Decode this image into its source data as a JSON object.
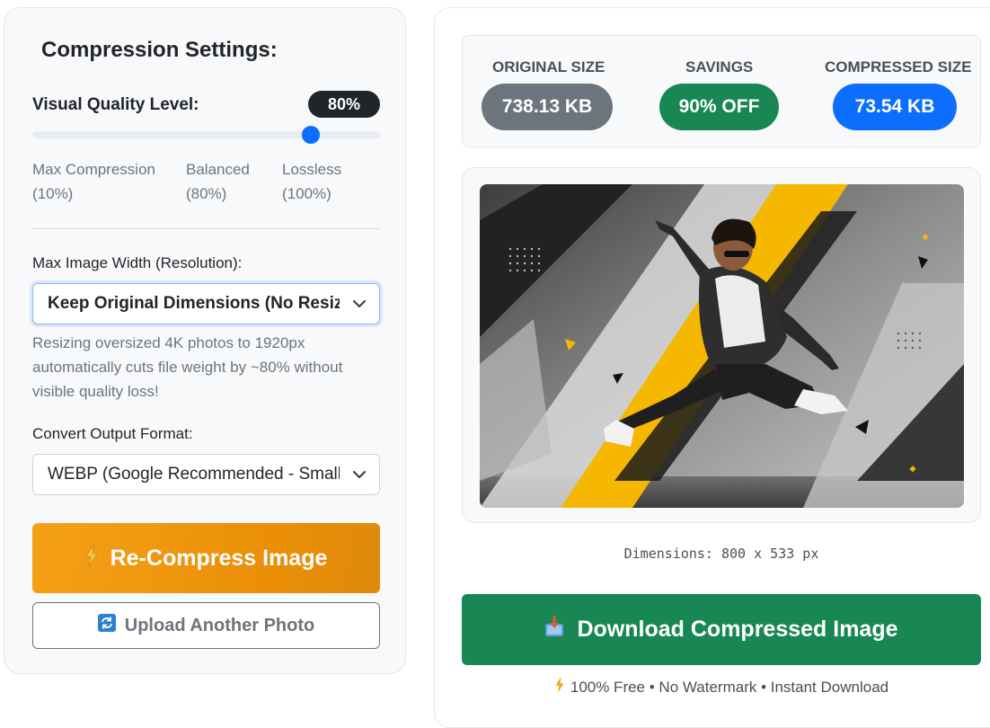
{
  "settings": {
    "title": "Compression Settings:",
    "quality_label": "Visual Quality Level:",
    "quality_value": "80%",
    "quality_fraction": 0.8,
    "slider_labels": [
      {
        "name": "Max Compression",
        "value": "(10%)"
      },
      {
        "name": "Balanced",
        "value": "(80%)"
      },
      {
        "name": "Lossless",
        "value": "(100%)"
      }
    ],
    "width_label": "Max Image Width (Resolution):",
    "width_selected": "Keep Original Dimensions (No Resize)",
    "width_help": "Resizing oversized 4K photos to 1920px automatically cuts file weight by ~80% without visible quality loss!",
    "format_label": "Convert Output Format:",
    "format_selected": "WEBP (Google Recommended - Smallest)",
    "compress_button": "Re-Compress Image",
    "upload_button": "Upload Another Photo"
  },
  "stats": {
    "original_label": "ORIGINAL SIZE",
    "original_value": "738.13 KB",
    "savings_label": "SAVINGS",
    "savings_value": "90% OFF",
    "compressed_label": "COMPRESSED SIZE",
    "compressed_value": "73.54 KB"
  },
  "preview": {
    "dimensions": "Dimensions: 800 x 533 px"
  },
  "download_button": "Download Compressed Image",
  "footer_note": "100% Free • No Watermark • Instant Download",
  "colors": {
    "accent": "#0d6efd",
    "compress_orange": "#f39c12",
    "download_green": "#198754",
    "original_gray": "#6c757d",
    "savings_green": "#198754",
    "compressed_blue": "#0d6efd"
  },
  "icons": {
    "compress_button": "lightning-icon",
    "upload_button": "refresh-icon",
    "download_button": "download-icon",
    "footer": "lightning-icon",
    "select": "chevron-down-icon"
  }
}
